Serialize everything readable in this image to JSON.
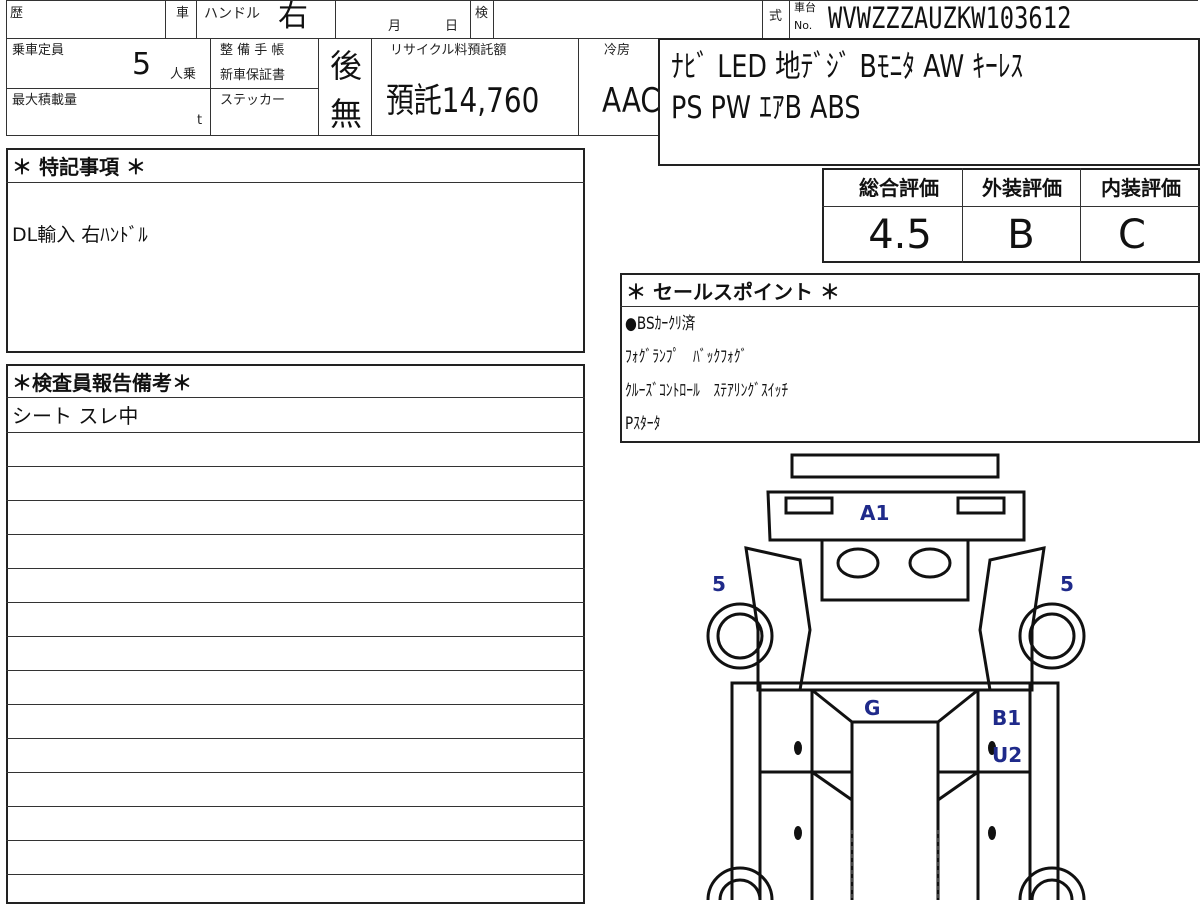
{
  "header": {
    "reki_label": "歴",
    "sha_label": "車",
    "handle_label": "ハンドル",
    "handle_value": "右",
    "month_label": "月",
    "day_label": "日",
    "ken_label": "検",
    "shiki_label": "式",
    "chassis_label_1": "車台",
    "chassis_label_2": "No.",
    "chassis_no": "WVWZZZAUZKW103612"
  },
  "row2": {
    "capacity_label": "乗車定員",
    "capacity_value": "5",
    "capacity_unit": "人乗",
    "maint_label_1": "整 備 手 帳",
    "maint_label_2": "新車保証書",
    "maint_value": "後",
    "recycle_label": "リサイクル料預託額",
    "recycle_value": "預託14,760",
    "cool_label": "冷房",
    "cool_value": "AAC",
    "maxload_label": "最大積載量",
    "maxload_unit": "t",
    "sticker_label": "ステッカー",
    "sticker_value": "無"
  },
  "equipment": {
    "line1": "ﾅﾋﾞ LED 地ﾃﾞｼﾞ Bﾓﾆﾀ AW ｷｰﾚｽ",
    "line2": "PS PW ｴｱB ABS"
  },
  "special": {
    "title": "＊ 特記事項 ＊",
    "text": "DL輸入 右ﾊﾝﾄﾞﾙ"
  },
  "inspector": {
    "title": "＊検査員報告備考＊",
    "line1": "シート スレ中"
  },
  "scores": {
    "overall_label": "総合評価",
    "overall_value": "4.5",
    "exterior_label": "外装評価",
    "exterior_value": "B",
    "interior_label": "内装評価",
    "interior_value": "C"
  },
  "sales": {
    "title": "＊ セールスポイント ＊",
    "lines": [
      "●BSｶｰｸﾘ済",
      "ﾌｫｸﾞﾗﾝﾌﾟ　ﾊﾞｯｸﾌｫｸﾞ",
      "ｸﾙｰｽﾞｺﾝﾄﾛｰﾙ　ｽﾃｱﾘﾝｸﾞｽｲｯﾁ",
      "Pｽﾀｰﾀ"
    ]
  },
  "damage": {
    "a1": "A1",
    "left_wheel": "5",
    "right_wheel": "5",
    "g": "G",
    "b1": "B1",
    "u2": "U2",
    "mark_color": "#1f2a8a"
  }
}
